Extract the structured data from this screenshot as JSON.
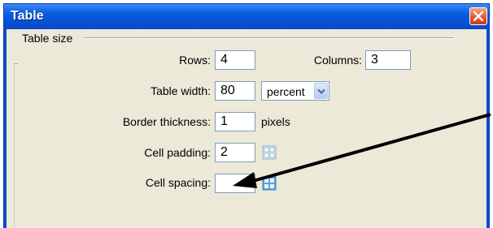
{
  "window": {
    "title": "Table"
  },
  "group": {
    "label": "Table size"
  },
  "fields": {
    "rows": {
      "label": "Rows:",
      "value": "4"
    },
    "columns": {
      "label": "Columns:",
      "value": "3"
    },
    "width": {
      "label": "Table width:",
      "value": "80",
      "unit_selected": "percent"
    },
    "border": {
      "label": "Border thickness:",
      "value": "1",
      "unit": "pixels"
    },
    "padding": {
      "label": "Cell padding:",
      "value": "2"
    },
    "spacing": {
      "label": "Cell spacing:",
      "value": ""
    }
  },
  "icons": {
    "close": "close-icon",
    "dropdown": "chevron-down-icon",
    "padding_grid": "cell-padding-grid-icon",
    "spacing_grid": "cell-spacing-grid-icon"
  },
  "colors": {
    "titlebar": "#0a5fe0",
    "annotation_arrow": "#000000"
  }
}
